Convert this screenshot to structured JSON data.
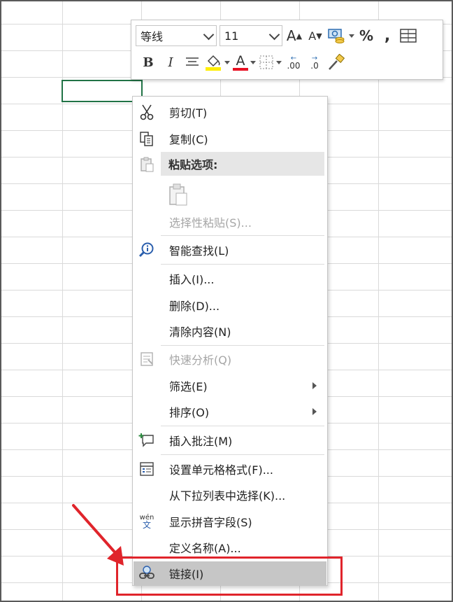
{
  "toolbar": {
    "font_name": "等线",
    "font_size": "11",
    "grow_font": "A",
    "shrink_font": "A",
    "percent": "%",
    "comma": ",",
    "bold": "B",
    "italic": "I",
    "font_color": "A",
    "dec_increase": ".00",
    "dec_decrease": ".0",
    "fill_color_hex": "#ffee00",
    "font_color_hex": "#e81123"
  },
  "context_menu": {
    "items": [
      {
        "label": "剪切(T)",
        "icon": "scissors-icon",
        "enabled": true
      },
      {
        "label": "复制(C)",
        "icon": "copy-icon",
        "enabled": true
      },
      {
        "label": "粘贴选项:",
        "icon": "paste-icon",
        "enabled": false,
        "header": true
      },
      {
        "label": "",
        "icon": "paste-option-icon",
        "enabled": false
      },
      {
        "label": "选择性粘贴(S)...",
        "icon": "",
        "enabled": false
      },
      {
        "label": "智能查找(L)",
        "icon": "smart-lookup-icon",
        "enabled": true
      },
      {
        "label": "插入(I)...",
        "icon": "",
        "enabled": true
      },
      {
        "label": "删除(D)...",
        "icon": "",
        "enabled": true
      },
      {
        "label": "清除内容(N)",
        "icon": "",
        "enabled": true
      },
      {
        "label": "快速分析(Q)",
        "icon": "quick-analysis-icon",
        "enabled": false
      },
      {
        "label": "筛选(E)",
        "icon": "",
        "enabled": true,
        "submenu": true
      },
      {
        "label": "排序(O)",
        "icon": "",
        "enabled": true,
        "submenu": true
      },
      {
        "label": "插入批注(M)",
        "icon": "insert-comment-icon",
        "enabled": true
      },
      {
        "label": "设置单元格格式(F)...",
        "icon": "format-cells-icon",
        "enabled": true
      },
      {
        "label": "从下拉列表中选择(K)...",
        "icon": "",
        "enabled": true
      },
      {
        "label": "显示拼音字段(S)",
        "icon": "phonetic-icon",
        "enabled": true
      },
      {
        "label": "定义名称(A)...",
        "icon": "",
        "enabled": true
      },
      {
        "label": "链接(I)",
        "icon": "link-icon",
        "enabled": true,
        "hovered": true
      }
    ],
    "phonetic_glyph_top": "wén",
    "phonetic_glyph_bottom": "文"
  },
  "colors": {
    "selection_border": "#217346",
    "highlight_border": "#e0242b",
    "hover_bg": "#c6c6c6"
  }
}
